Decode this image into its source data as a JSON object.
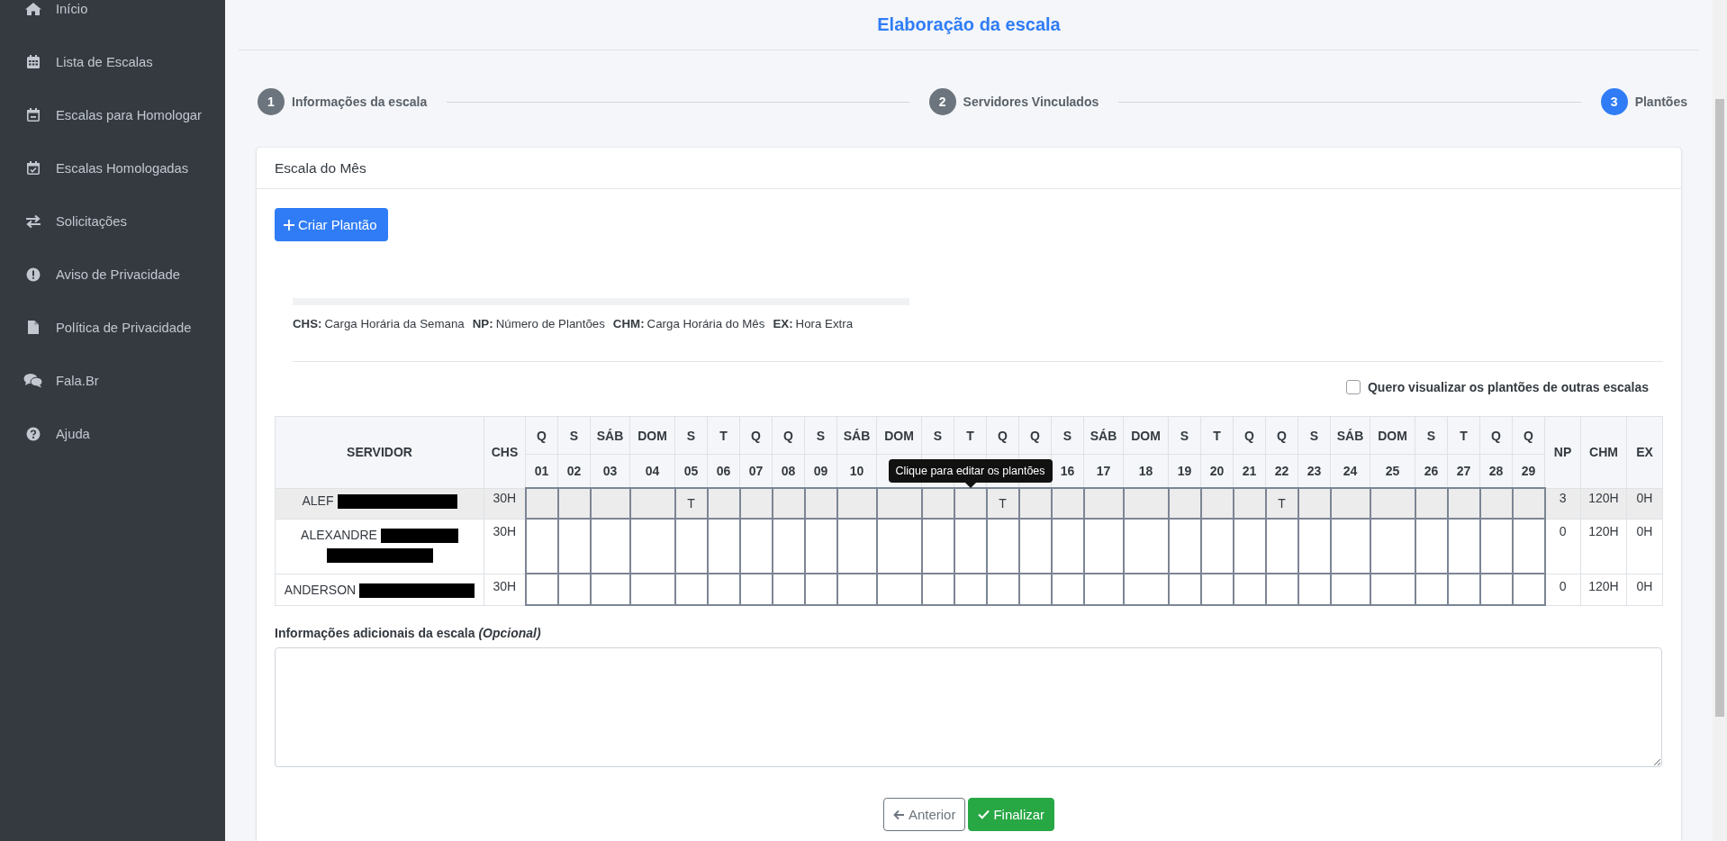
{
  "sidebar": {
    "items": [
      {
        "label": "Início"
      },
      {
        "label": "Lista de Escalas"
      },
      {
        "label": "Escalas para Homologar"
      },
      {
        "label": "Escalas Homologadas"
      },
      {
        "label": "Solicitações"
      },
      {
        "label": "Aviso de Privacidade"
      },
      {
        "label": "Política de Privacidade"
      },
      {
        "label": "Fala.Br"
      },
      {
        "label": "Ajuda"
      }
    ]
  },
  "header": {
    "title": "Elaboração da escala"
  },
  "stepper": {
    "steps": [
      {
        "number": "1",
        "label": "Informações da escala",
        "selected": false
      },
      {
        "number": "2",
        "label": "Servidores Vinculados",
        "selected": false
      },
      {
        "number": "3",
        "label": "Plantões",
        "selected": true
      }
    ]
  },
  "card": {
    "title": "Escala do Mês",
    "create_button": "Criar Plantão",
    "legend": [
      {
        "abbr": "CHS:",
        "text": "Carga Horária da Semana"
      },
      {
        "abbr": "NP:",
        "text": "Número de Plantões"
      },
      {
        "abbr": "CHM:",
        "text": "Carga Horária do Mês"
      },
      {
        "abbr": "EX:",
        "text": "Hora Extra"
      }
    ],
    "checkbox": {
      "label": "Quero visualizar os plantões de outras escalas",
      "checked": false
    },
    "table": {
      "columns": {
        "servidor": "SERVIDOR",
        "chs": "CHS",
        "np": "NP",
        "chm": "CHM",
        "ex": "EX"
      },
      "days": [
        {
          "weekday": "Q",
          "number": "01"
        },
        {
          "weekday": "S",
          "number": "02"
        },
        {
          "weekday": "SÁB",
          "number": "03"
        },
        {
          "weekday": "DOM",
          "number": "04"
        },
        {
          "weekday": "S",
          "number": "05"
        },
        {
          "weekday": "T",
          "number": "06"
        },
        {
          "weekday": "Q",
          "number": "07"
        },
        {
          "weekday": "Q",
          "number": "08"
        },
        {
          "weekday": "S",
          "number": "09"
        },
        {
          "weekday": "SÁB",
          "number": "10"
        },
        {
          "weekday": "DOM"
        },
        {
          "weekday": "S"
        },
        {
          "weekday": "T"
        },
        {
          "weekday": "Q"
        },
        {
          "weekday": "Q"
        },
        {
          "weekday": "S",
          "number": "16"
        },
        {
          "weekday": "SÁB",
          "number": "17"
        },
        {
          "weekday": "DOM",
          "number": "18"
        },
        {
          "weekday": "S",
          "number": "19"
        },
        {
          "weekday": "T",
          "number": "20"
        },
        {
          "weekday": "Q",
          "number": "21"
        },
        {
          "weekday": "Q",
          "number": "22"
        },
        {
          "weekday": "S",
          "number": "23"
        },
        {
          "weekday": "SÁB",
          "number": "24"
        },
        {
          "weekday": "DOM",
          "number": "25"
        },
        {
          "weekday": "S",
          "number": "26"
        },
        {
          "weekday": "T",
          "number": "27"
        },
        {
          "weekday": "Q",
          "number": "28"
        },
        {
          "weekday": "Q",
          "number": "29"
        }
      ],
      "rows": [
        {
          "name": "ALEF",
          "kind": "inline",
          "highlighted": true,
          "chs": "30H",
          "np": "3",
          "chm": "120H",
          "ex": "0H",
          "cells": [
            {
              "kind": "empty"
            },
            {
              "kind": "empty"
            },
            {
              "kind": "empty"
            },
            {
              "kind": "empty"
            },
            {
              "kind": "shift",
              "text": "T"
            },
            {
              "kind": "empty"
            },
            {
              "kind": "empty"
            },
            {
              "kind": "empty"
            },
            {
              "kind": "empty"
            },
            {
              "kind": "empty"
            },
            {
              "kind": "empty"
            },
            {
              "kind": "empty"
            },
            {
              "kind": "empty",
              "tooltip": "Clique para editar os plantões"
            },
            {
              "kind": "shift",
              "text": "T"
            },
            {
              "kind": "empty"
            },
            {
              "kind": "empty"
            },
            {
              "kind": "empty"
            },
            {
              "kind": "empty"
            },
            {
              "kind": "empty"
            },
            {
              "kind": "empty"
            },
            {
              "kind": "empty"
            },
            {
              "kind": "shift",
              "text": "T"
            },
            {
              "kind": "empty"
            },
            {
              "kind": "empty"
            },
            {
              "kind": "empty"
            },
            {
              "kind": "empty"
            },
            {
              "kind": "empty"
            },
            {
              "kind": "empty"
            },
            {
              "kind": "empty"
            }
          ]
        },
        {
          "name": "ALEXANDRE",
          "kind": "wrapped",
          "highlighted": false,
          "chs": "30H",
          "np": "0",
          "chm": "120H",
          "ex": "0H",
          "cells": [
            {
              "kind": "empty"
            },
            {
              "kind": "empty"
            },
            {
              "kind": "empty"
            },
            {
              "kind": "empty"
            },
            {
              "kind": "empty"
            },
            {
              "kind": "empty"
            },
            {
              "kind": "empty"
            },
            {
              "kind": "empty"
            },
            {
              "kind": "empty"
            },
            {
              "kind": "empty"
            },
            {
              "kind": "empty"
            },
            {
              "kind": "empty"
            },
            {
              "kind": "empty"
            },
            {
              "kind": "empty"
            },
            {
              "kind": "empty"
            },
            {
              "kind": "empty"
            },
            {
              "kind": "empty"
            },
            {
              "kind": "empty"
            },
            {
              "kind": "empty"
            },
            {
              "kind": "empty"
            },
            {
              "kind": "empty"
            },
            {
              "kind": "empty"
            },
            {
              "kind": "empty"
            },
            {
              "kind": "empty"
            },
            {
              "kind": "empty"
            },
            {
              "kind": "empty"
            },
            {
              "kind": "empty"
            },
            {
              "kind": "empty"
            },
            {
              "kind": "empty"
            }
          ]
        },
        {
          "name": "ANDERSON",
          "kind": "inline",
          "highlighted": false,
          "chs": "30H",
          "np": "0",
          "chm": "120H",
          "ex": "0H",
          "cells": [
            {
              "kind": "empty"
            },
            {
              "kind": "empty"
            },
            {
              "kind": "empty"
            },
            {
              "kind": "empty"
            },
            {
              "kind": "empty"
            },
            {
              "kind": "empty"
            },
            {
              "kind": "empty"
            },
            {
              "kind": "empty"
            },
            {
              "kind": "empty"
            },
            {
              "kind": "empty"
            },
            {
              "kind": "empty"
            },
            {
              "kind": "empty"
            },
            {
              "kind": "empty"
            },
            {
              "kind": "empty"
            },
            {
              "kind": "empty"
            },
            {
              "kind": "empty"
            },
            {
              "kind": "empty"
            },
            {
              "kind": "empty"
            },
            {
              "kind": "empty"
            },
            {
              "kind": "empty"
            },
            {
              "kind": "empty"
            },
            {
              "kind": "empty"
            },
            {
              "kind": "empty"
            },
            {
              "kind": "empty"
            },
            {
              "kind": "empty"
            },
            {
              "kind": "empty"
            },
            {
              "kind": "empty"
            },
            {
              "kind": "empty"
            },
            {
              "kind": "empty"
            }
          ]
        }
      ]
    },
    "notes": {
      "label": "Informações adicionais da escala *(Opcional)*"
    },
    "buttons": [
      {
        "label": "Anterior",
        "kind": "secondary"
      },
      {
        "label": "Finalizar",
        "kind": "primary"
      }
    ]
  }
}
